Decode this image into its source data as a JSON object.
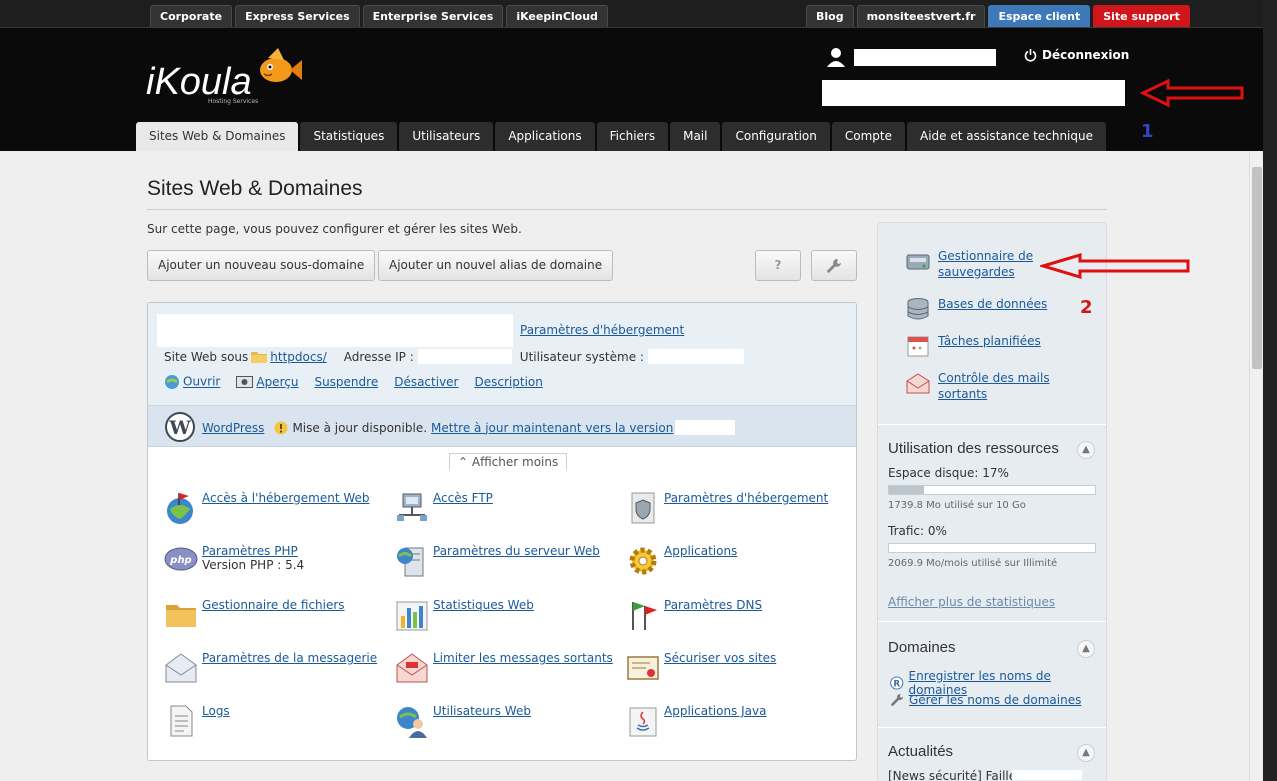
{
  "top_nav": {
    "left": [
      "Corporate",
      "Express Services",
      "Enterprise Services",
      "iKeepinCloud"
    ],
    "right": [
      "Blog",
      "monsiteestvert.fr",
      "Espace client",
      "Site support"
    ]
  },
  "header": {
    "logo_text": "iKoula",
    "logo_tagline": "Hosting Services",
    "logout": "Déconnexion",
    "annotation_1": "1"
  },
  "main_nav": [
    "Sites Web & Domaines",
    "Statistiques",
    "Utilisateurs",
    "Applications",
    "Fichiers",
    "Mail",
    "Configuration",
    "Compte",
    "Aide et assistance technique"
  ],
  "page": {
    "title": "Sites Web & Domaines",
    "intro": "Sur cette page, vous pouvez configurer et gérer les sites Web.",
    "btn_add_subdomain": "Ajouter un nouveau sous-domaine",
    "btn_add_alias": "Ajouter un nouvel alias de domaine",
    "btn_help": "?"
  },
  "site": {
    "hosting_params_link": "Paramètres d'hébergement",
    "site_under": "Site Web sous",
    "docroot": "httpdocs/",
    "ip_label": "Adresse IP :",
    "sysuser_label": "Utilisateur système :",
    "actions": [
      "Ouvrir",
      "Aperçu",
      "Suspendre",
      "Désactiver",
      "Description"
    ],
    "wordpress": "WordPress",
    "update_text": "Mise à jour disponible.",
    "update_link": "Mettre à jour maintenant vers la version",
    "show_less": "Afficher moins"
  },
  "tools": [
    {
      "label": "Accès à l'hébergement Web",
      "icon": "globe-flag-icon"
    },
    {
      "label": "Accès FTP",
      "icon": "ftp-network-icon"
    },
    {
      "label": "Paramètres d'hébergement",
      "icon": "hosting-shield-icon"
    },
    {
      "label": "Paramètres PHP",
      "icon": "php-icon",
      "sub": "Version PHP : 5.4"
    },
    {
      "label": "Paramètres du serveur Web",
      "icon": "web-server-icon"
    },
    {
      "label": "Applications",
      "icon": "gear-icon"
    },
    {
      "label": "Gestionnaire de fichiers",
      "icon": "folder-icon"
    },
    {
      "label": "Statistiques Web",
      "icon": "bar-chart-icon"
    },
    {
      "label": "Paramètres DNS",
      "icon": "dns-flags-icon"
    },
    {
      "label": "Paramètres de la messagerie",
      "icon": "envelope-icon"
    },
    {
      "label": "Limiter les messages sortants",
      "icon": "mail-limit-icon"
    },
    {
      "label": "Sécuriser vos sites",
      "icon": "certificate-icon"
    },
    {
      "label": "Logs",
      "icon": "log-document-icon"
    },
    {
      "label": "Utilisateurs Web",
      "icon": "web-users-icon"
    },
    {
      "label": "Applications Java",
      "icon": "java-icon"
    }
  ],
  "sidebar": {
    "links": [
      {
        "label": "Gestionnaire de sauvegardes",
        "icon": "backup-drive-icon"
      },
      {
        "label": "Bases de données",
        "icon": "database-icon"
      },
      {
        "label": "Tâches planifiées",
        "icon": "calendar-icon"
      },
      {
        "label": "Contrôle des mails sortants",
        "icon": "mail-control-icon"
      }
    ],
    "annotation_2": "2",
    "resources": {
      "title": "Utilisation des ressources",
      "disk_label": "Espace disque: 17%",
      "disk_percent": 17,
      "disk_detail": "1739.8 Mo utilisé sur 10 Go",
      "traffic_label": "Trafic: 0%",
      "traffic_percent": 0,
      "traffic_detail": "2069.9 Mo/mois utilisé sur Illimité",
      "more_stats": "Afficher plus de statistiques"
    },
    "domains": {
      "title": "Domaines",
      "links": [
        "Enregistrer les noms de domaines",
        "Gérer les noms de domaines"
      ]
    },
    "news": {
      "title": "Actualités",
      "first_item": "[News sécurité] Faille"
    }
  },
  "colors": {
    "header_bg": "#0a0a0a",
    "link": "#1a5a9a",
    "espace_client": "#3d78b8",
    "site_support": "#d0151b",
    "annotation_arrow": "#e01010",
    "annotation_1": "#3246c0"
  }
}
